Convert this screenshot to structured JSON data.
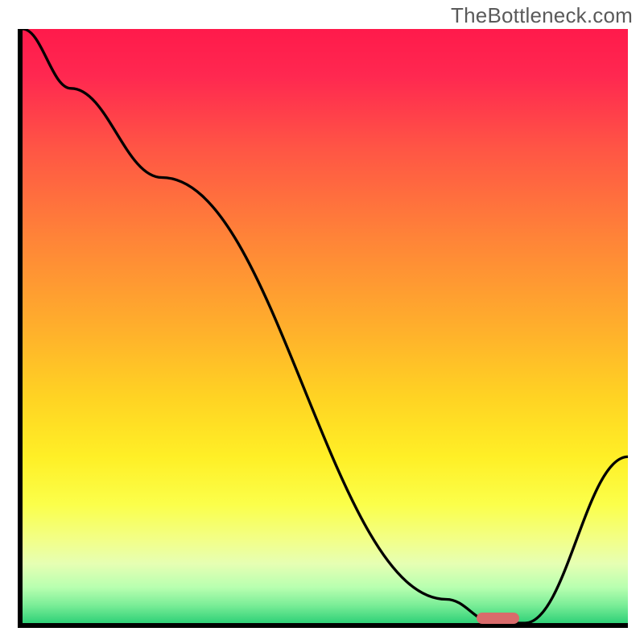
{
  "watermark": "TheBottleneck.com",
  "chart_data": {
    "type": "line",
    "title": "",
    "xlabel": "",
    "ylabel": "",
    "x_range": [
      0,
      100
    ],
    "y_range": [
      0,
      100
    ],
    "series": [
      {
        "name": "curve",
        "x": [
          0,
          8,
          23,
          70,
          78,
          83,
          100
        ],
        "y": [
          100,
          90,
          75,
          4,
          0,
          0,
          28
        ]
      }
    ],
    "marker": {
      "x_start": 75,
      "x_end": 82,
      "y": 0,
      "color": "#d96b6b"
    },
    "background_gradient_stops": [
      {
        "pos": 0.0,
        "color": "#ff1a4b"
      },
      {
        "pos": 0.08,
        "color": "#ff2850"
      },
      {
        "pos": 0.2,
        "color": "#ff5545"
      },
      {
        "pos": 0.35,
        "color": "#ff8338"
      },
      {
        "pos": 0.5,
        "color": "#ffae2c"
      },
      {
        "pos": 0.62,
        "color": "#ffd323"
      },
      {
        "pos": 0.72,
        "color": "#ffef26"
      },
      {
        "pos": 0.8,
        "color": "#fbff4a"
      },
      {
        "pos": 0.86,
        "color": "#f2ff88"
      },
      {
        "pos": 0.9,
        "color": "#e6ffb3"
      },
      {
        "pos": 0.94,
        "color": "#b8ffb0"
      },
      {
        "pos": 0.97,
        "color": "#7aed97"
      },
      {
        "pos": 1.0,
        "color": "#2fd178"
      }
    ]
  }
}
